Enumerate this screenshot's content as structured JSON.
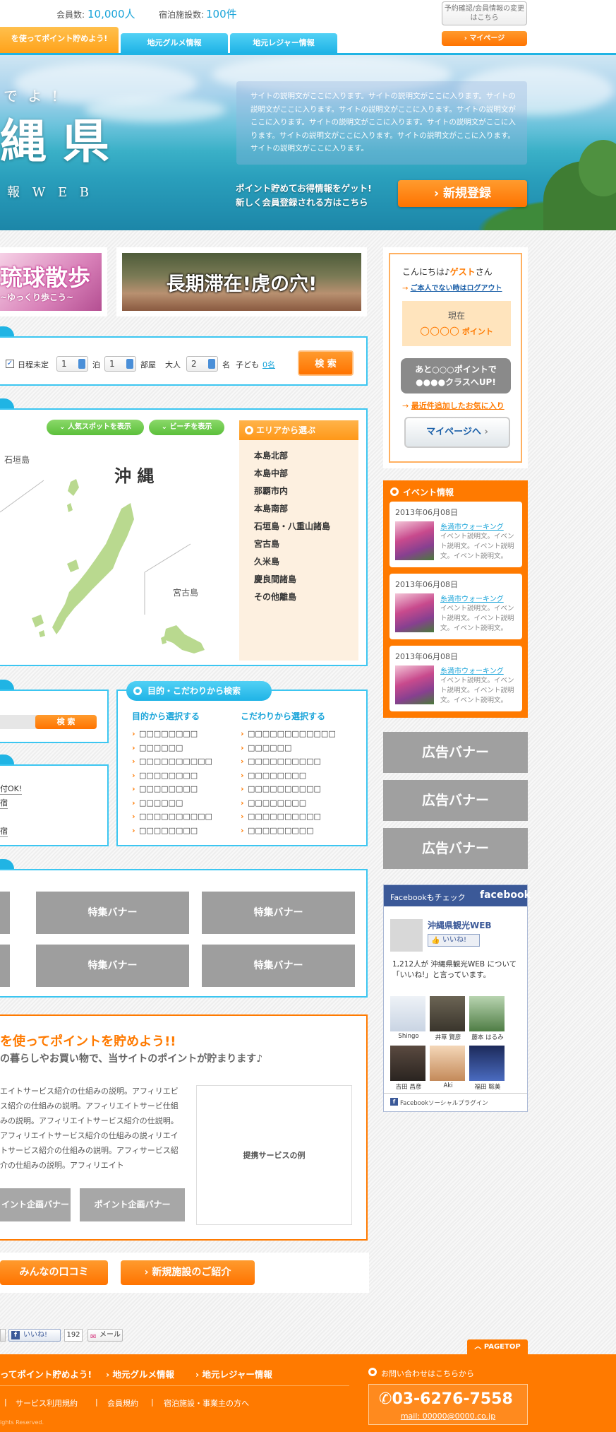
{
  "header": {
    "members_label": "会員数:",
    "members_value": "10,000人",
    "facilities_label": "宿泊施設数:",
    "facilities_value": "100件",
    "reserve_button": "予約確認/会員情報の変更はこちら",
    "mypage_button": "マイページ",
    "tabs": [
      {
        "label": "を使ってポイント貯めよう!"
      },
      {
        "label": "地元グルメ情報"
      },
      {
        "label": "地元レジャー情報"
      }
    ]
  },
  "hero": {
    "kicker": "で よ !",
    "title": "縄 県",
    "subtitle": "報 W E B",
    "description": "サイトの説明文がここに入ります。サイトの説明文がここに入ります。サイトの説明文がここに入ります。サイトの説明文がここに入ります。サイトの説明文がここに入ります。サイトの説明文がここに入ります。サイトの説明文がここに入ります。サイトの説明文がここに入ります。サイトの説明文がここに入ります。サイトの説明文がここに入ります。",
    "promo_line1": "ポイント貯めてお得情報をゲット!",
    "promo_line2": "新しく会員登録される方はこちら",
    "register_button": "新規登録"
  },
  "banners": {
    "ryukyu_main": "琉球散歩",
    "ryukyu_sub": "~ゆっくり歩こう~",
    "longstay": "長期滞在!虎の穴!"
  },
  "search": {
    "undecided_label": "日程未定",
    "nights_value": "1",
    "nights_unit": "泊",
    "rooms_value": "1",
    "rooms_unit": "部屋",
    "adults_label": "大人",
    "adults_value": "2",
    "adults_unit": "名",
    "children_label": "子ども",
    "children_value": "0名",
    "search_button": "検 索"
  },
  "map": {
    "popular_button": "人気スポットを表示",
    "beach_button": "ビーチを表示",
    "title": "沖 縄",
    "ishigaki_label": "石垣島",
    "miyako_label": "宮古島",
    "area_header": "エリアから選ぶ",
    "areas": [
      {
        "label": "本島北部"
      },
      {
        "label": "本島中部"
      },
      {
        "label": "那覇市内"
      },
      {
        "label": "本島南部"
      },
      {
        "label": "石垣島・八重山諸島"
      },
      {
        "label": "宮古島"
      },
      {
        "label": "久米島"
      },
      {
        "label": "慶良間諸島"
      },
      {
        "label": "その他離島"
      }
    ]
  },
  "keyword": {
    "search_button": "検 索"
  },
  "left_list": [
    "付OK!",
    "宿",
    "宿"
  ],
  "purpose": {
    "header": "目的・こだわりから検索",
    "purpose_title": "目的から選択する",
    "purpose_items": [
      {
        "label": "□□□□□□□□"
      },
      {
        "label": "□□□□□□"
      },
      {
        "label": "□□□□□□□□□□"
      },
      {
        "label": "□□□□□□□□"
      },
      {
        "label": "□□□□□□□□"
      },
      {
        "label": "□□□□□□"
      },
      {
        "label": "□□□□□□□□□□"
      },
      {
        "label": "□□□□□□□□"
      }
    ],
    "kodawari_title": "こだわりから選択する",
    "kodawari_items": [
      {
        "label": "□□□□□□□□□□□□"
      },
      {
        "label": "□□□□□□"
      },
      {
        "label": "□□□□□□□□□□"
      },
      {
        "label": "□□□□□□□□"
      },
      {
        "label": "□□□□□□□□□□"
      },
      {
        "label": "□□□□□□□□"
      },
      {
        "label": "□□□□□□□□□□"
      },
      {
        "label": "□□□□□□□□□"
      }
    ]
  },
  "feature_banners": [
    "特集バナー",
    "特集バナー",
    "特集バナー",
    "特集バナー"
  ],
  "points": {
    "title": "を使ってポイントを貯めよう!!",
    "subtitle": "の暮らしやお買い物で、当サイトのポイントが貯まります♪",
    "description": "エイトサービス紹介の仕組みの説明。アフィリエビス紹介の仕組みの説明。アフィリエイトサービ仕組みの説明。アフィリエイトサービス紹介の仕説明。アフィリエイトサービス紹介の仕組みの説ィリエイトサービス紹介の仕組みの説明。アフィサービス紹介の仕組みの説明。アフィリエイト",
    "banner1": "イント企画バナー",
    "banner2": "ポイント企画バナー",
    "example": "提携サービスの例"
  },
  "bottom_buttons": {
    "review": "みんなの口コミ",
    "new_facility": "新規施設のご紹介"
  },
  "social": {
    "like": "いいね!",
    "like_count": "192",
    "mail": "メール"
  },
  "pagetop": "PAGETOP",
  "sidebar": {
    "greeting_prefix": "こんにちは♪",
    "greeting_name": "ゲスト",
    "greeting_suffix": "さん",
    "logout_link": "ご本人でない時はログアウト",
    "current_label": "現在",
    "points_value": "○○○○",
    "points_unit": "ポイント",
    "upgrade_line1": "あと○○○ポイントで",
    "upgrade_line2": "●●●●クラスへUP!",
    "favorites_link": "最近件追加したお気に入り",
    "mypage_button": "マイページへ",
    "events_title": "イベント情報",
    "events": [
      {
        "date": "2013年06月08日",
        "title": "糸満市ウォーキング",
        "desc": "イベント説明文。イベント説明文。イベント説明文。イベント説明文。"
      },
      {
        "date": "2013年06月08日",
        "title": "糸満市ウォーキング",
        "desc": "イベント説明文。イベント説明文。イベント説明文。イベント説明文。"
      },
      {
        "date": "2013年06月08日",
        "title": "糸満市ウォーキング",
        "desc": "イベント説明文。イベント説明文。イベント説明文。イベント説明文。"
      }
    ],
    "ads": [
      "広告バナー",
      "広告バナー",
      "広告バナー"
    ],
    "facebook": {
      "header": "Facebookもチェック",
      "logo": "facebook",
      "page_name": "沖縄県観光WEB",
      "like": "いいね!",
      "fans_text": "1,212人が 沖縄県観光WEB について「いいね!」と言っています。",
      "fans": [
        {
          "name": "Shingo"
        },
        {
          "name": "井草 賢彦"
        },
        {
          "name": "藤本 はるみ"
        },
        {
          "name": "吉田 昌彦"
        },
        {
          "name": "Aki"
        },
        {
          "name": "福田 聡美"
        }
      ],
      "plugin": "Facebookソーシャルプラグイン"
    }
  },
  "footer": {
    "links": [
      "ってポイント貯めよう!",
      "地元グルメ情報",
      "地元レジャー情報"
    ],
    "sublinks": [
      "サービス利用規約",
      "会員規約",
      "宿泊施設・事業主の方へ"
    ],
    "contact_label": "お問い合わせはこちらから",
    "phone": "03-6276-7558",
    "mail": "mail: 00000@0000.co.jp",
    "copyright": "ights Reserved."
  },
  "colors": {
    "accent_blue": "#20b4e4",
    "accent_orange": "#ff7a00",
    "map_green": "#b9d98f"
  }
}
